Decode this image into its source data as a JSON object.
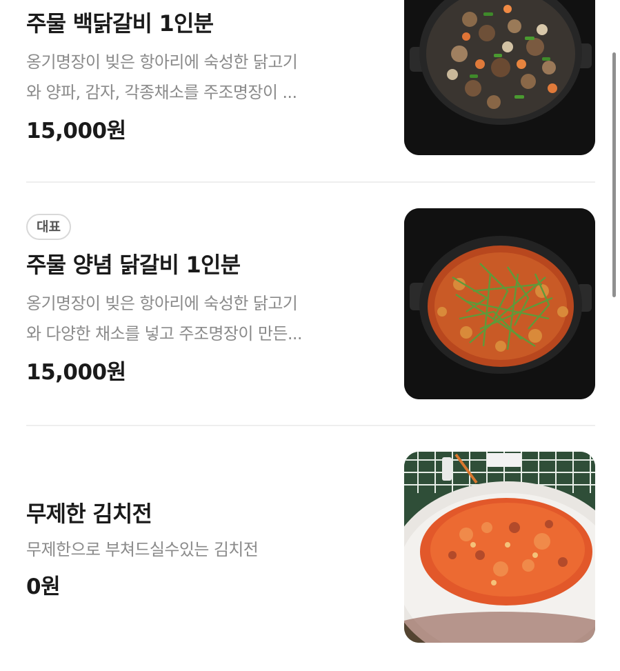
{
  "menu": {
    "items": [
      {
        "name": "주물 백닭갈비 1인분",
        "badge": "",
        "desc_line1": "옹기명장이 빚은 항아리에 숙성한 닭고기",
        "desc_line2": "와 양파, 감자, 각종채소를 주조명장이 ...",
        "price": "15,000원",
        "image_icon": "white-dakgalbi-pan-photo"
      },
      {
        "name": "주물 양념 닭갈비 1인분",
        "badge": "대표",
        "desc_line1": "옹기명장이 빚은 항아리에 숙성한 닭고기",
        "desc_line2": "와 다양한 채소를 넣고 주조명장이 만든...",
        "price": "15,000원",
        "image_icon": "spicy-dakgalbi-pan-photo"
      },
      {
        "name": "무제한 김치전",
        "badge": "",
        "desc_line1": "무제한으로 부쳐드실수있는 김치전",
        "desc_line2": "",
        "price": "0원",
        "image_icon": "kimchi-pancake-photo"
      }
    ]
  },
  "colors": {
    "title": "#1a1a1a",
    "description": "#8a8a8a",
    "divider": "#eeeeee",
    "badge_border": "#d8d8d8"
  }
}
